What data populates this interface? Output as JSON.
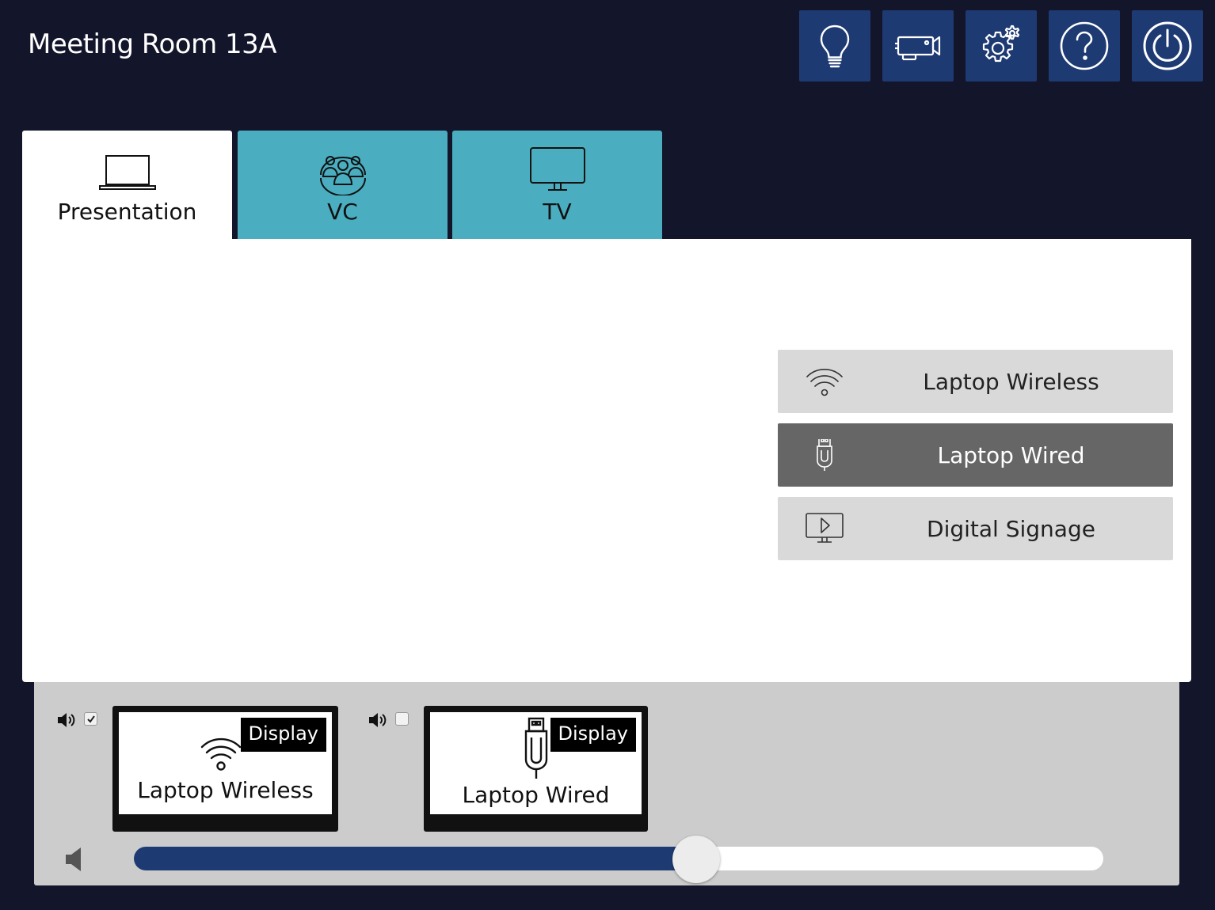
{
  "header": {
    "title": "Meeting Room 13A",
    "buttons": [
      {
        "name": "lighting",
        "icon": "lightbulb-icon"
      },
      {
        "name": "camera",
        "icon": "camera-icon"
      },
      {
        "name": "settings",
        "icon": "gears-icon"
      },
      {
        "name": "help",
        "icon": "question-icon"
      },
      {
        "name": "power",
        "icon": "power-icon"
      }
    ]
  },
  "tabs": [
    {
      "label": "Presentation",
      "icon": "laptop-icon",
      "active": true
    },
    {
      "label": "VC",
      "icon": "people-group-icon",
      "active": false
    },
    {
      "label": "TV",
      "icon": "tv-icon",
      "active": false
    }
  ],
  "sources": [
    {
      "label": "Laptop Wireless",
      "icon": "wifi-icon",
      "active": false
    },
    {
      "label": "Laptop Wired",
      "icon": "usb-icon",
      "active": true
    },
    {
      "label": "Digital Signage",
      "icon": "signage-icon",
      "active": false
    }
  ],
  "displays": [
    {
      "badge": "Display",
      "label": "Laptop Wireless",
      "icon": "wifi-icon",
      "audio_checked": true
    },
    {
      "badge": "Display",
      "label": "Laptop Wired",
      "icon": "usb-icon",
      "audio_checked": false
    }
  ],
  "volume": {
    "level": 0.58,
    "mute_icon": "speaker-mute-icon"
  },
  "colors": {
    "background": "#13152a",
    "header_button": "#1e3a73",
    "tab_inactive": "#4aaec0",
    "source_active": "#666666",
    "source_inactive": "#d9d9d9",
    "volume_fill": "#1e3a73"
  }
}
